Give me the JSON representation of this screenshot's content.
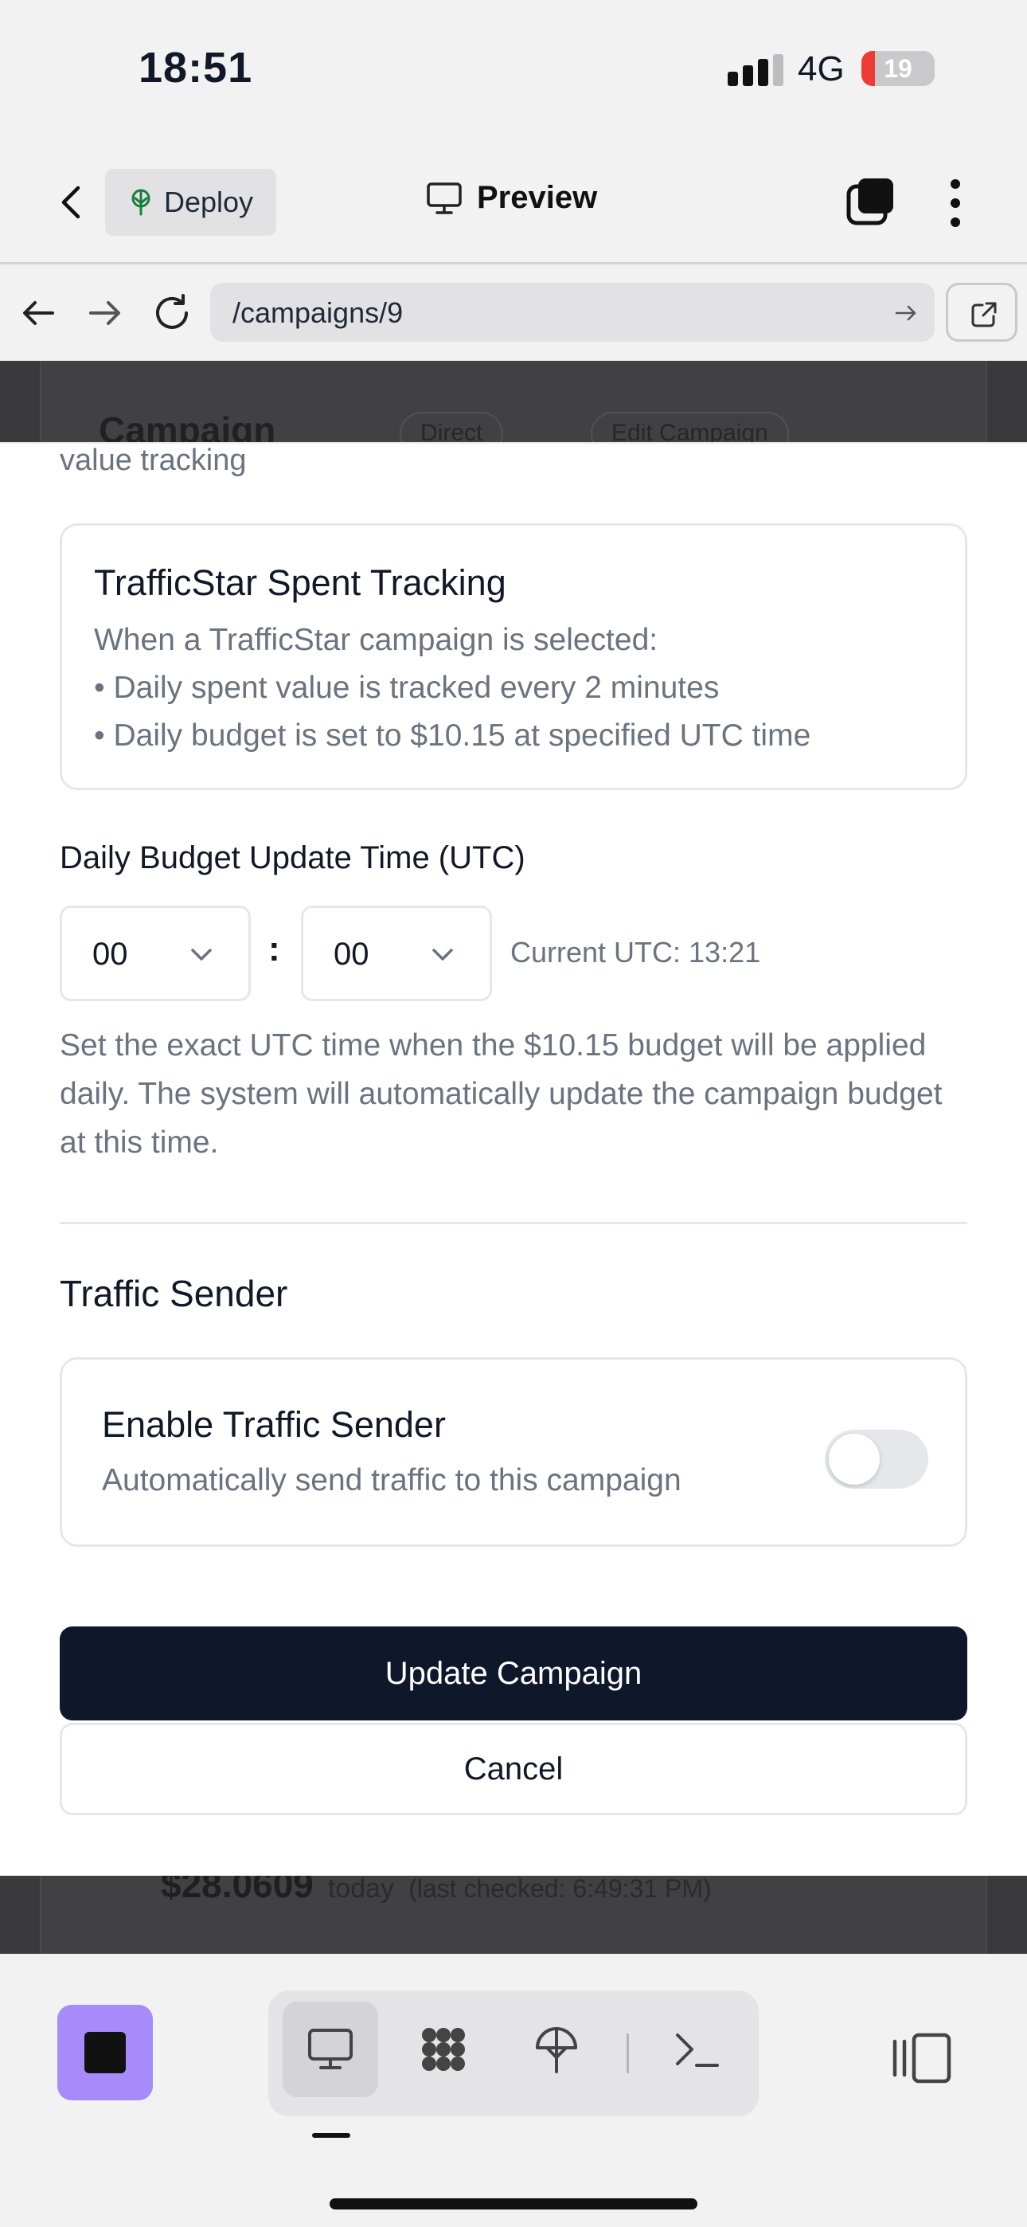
{
  "status_bar": {
    "time": "18:51",
    "network": "4G",
    "battery_level": "19",
    "battery_fraction": 0.19
  },
  "app_bar": {
    "deploy_label": "Deploy",
    "preview_label": "Preview"
  },
  "browser": {
    "url": "/campaigns/9"
  },
  "background_page": {
    "title": "Campaign",
    "pill_1": "Direct",
    "pill_2": "Edit Campaign",
    "spent_amount": "$28.0609",
    "spent_suffix": "today",
    "last_checked": "(last checked: 6:49:31 PM)"
  },
  "modal": {
    "section_tail": "value tracking",
    "trafficstar_box": {
      "title": "TrafficStar Spent Tracking",
      "lines": [
        "When a TrafficStar campaign is selected:",
        "• Daily spent value is tracked every 2 minutes",
        "• Daily budget is set to $10.15 at specified UTC time"
      ]
    },
    "budget_time": {
      "label": "Daily Budget Update Time (UTC)",
      "hour": "00",
      "minute": "00",
      "separator": ":",
      "current_utc": "Current UTC: 13:21",
      "help_text": "Set the exact UTC time when the $10.15 budget will be applied daily. The system will automatically update the campaign budget at this time."
    },
    "traffic_sender": {
      "heading": "Traffic Sender",
      "title": "Enable Traffic Sender",
      "description": "Automatically send traffic to this campaign",
      "enabled": false
    },
    "update_label": "Update Campaign",
    "cancel_label": "Cancel"
  },
  "icons": {
    "back": "chevron-left-icon",
    "deploy": "deploy-tree-icon",
    "preview": "monitor-icon",
    "tabs": "tabs-icon",
    "menu": "kebab-icon",
    "nav_back": "arrow-left-icon",
    "nav_forward": "arrow-right-icon",
    "reload": "reload-icon",
    "open_external": "external-link-icon",
    "stop": "stop-icon",
    "tools": [
      "monitor-icon",
      "grid-dots-icon",
      "deploy-tree-icon",
      "terminal-icon"
    ],
    "panel": "panel-toggle-icon"
  },
  "colors": {
    "primary_button": "#0f172a",
    "stop_button": "#a78bfa",
    "battery_low": "#ef3b35"
  }
}
